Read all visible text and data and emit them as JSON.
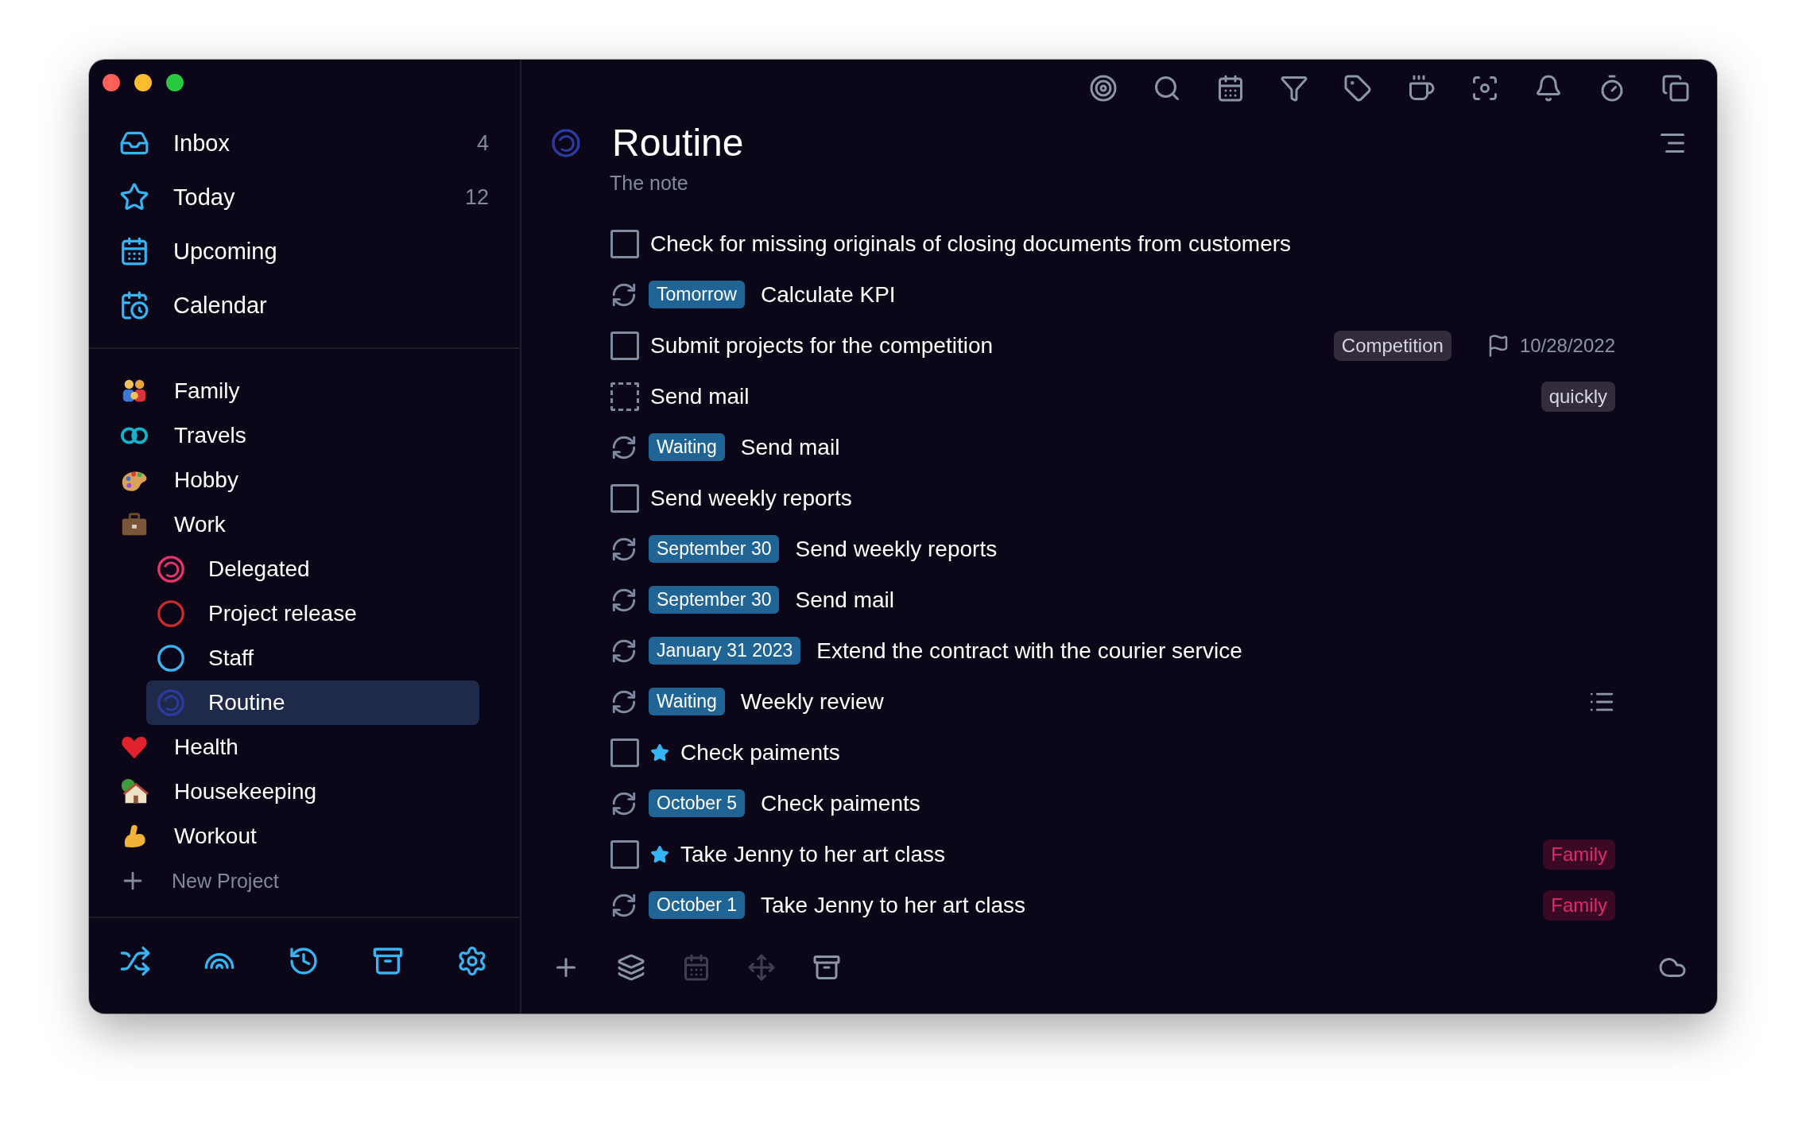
{
  "sidebar": {
    "nav": [
      {
        "label": "Inbox",
        "count": "4",
        "selected": false
      },
      {
        "label": "Today",
        "count": "12",
        "selected": false
      },
      {
        "label": "Upcoming",
        "selected": false
      },
      {
        "label": "Calendar",
        "selected": false
      }
    ],
    "projects": [
      {
        "label": "Family",
        "selected": false
      },
      {
        "label": "Travels",
        "selected": false
      },
      {
        "label": "Hobby",
        "selected": false
      },
      {
        "label": "Work",
        "selected": false,
        "children": [
          {
            "label": "Delegated",
            "kind": "partial",
            "color": "#e8336b",
            "selected": false
          },
          {
            "label": "Project release",
            "kind": "full",
            "color": "#c92a2a",
            "selected": false
          },
          {
            "label": "Staff",
            "kind": "full",
            "color": "#3db4f2",
            "selected": false
          },
          {
            "label": "Routine",
            "kind": "partial",
            "color": "#2b3a9c",
            "selected": true
          }
        ]
      },
      {
        "label": "Health",
        "selected": false
      },
      {
        "label": "Housekeeping",
        "selected": false
      },
      {
        "label": "Workout",
        "selected": false
      }
    ],
    "new_project": "New Project"
  },
  "project": {
    "title": "Routine",
    "note": "The note"
  },
  "tasks": [
    {
      "kind": "checkbox",
      "checked": false,
      "starred": false,
      "title": "Check for missing originals of closing documents from customers"
    },
    {
      "kind": "repeat",
      "badge": "Tomorrow",
      "title": "Calculate KPI"
    },
    {
      "kind": "checkbox",
      "checked": false,
      "starred": false,
      "title": "Submit projects for the competition",
      "tags": [
        {
          "label": "Competition",
          "color": "#322c3c"
        }
      ],
      "deadline": "10/28/2022"
    },
    {
      "kind": "someday",
      "checked": false,
      "starred": false,
      "title": "Send mail",
      "tags": [
        {
          "label": "quickly",
          "color": "#322c3c"
        }
      ]
    },
    {
      "kind": "repeat",
      "badge": "Waiting",
      "title": "Send mail"
    },
    {
      "kind": "checkbox",
      "checked": false,
      "starred": false,
      "title": "Send weekly reports"
    },
    {
      "kind": "repeat",
      "badge": "September 30",
      "title": "Send weekly reports"
    },
    {
      "kind": "repeat",
      "badge": "September 30",
      "title": "Send mail"
    },
    {
      "kind": "repeat",
      "badge": "January 31 2023",
      "title": "Extend the contract with the courier service"
    },
    {
      "kind": "repeat",
      "badge": "Waiting",
      "title": "Weekly review",
      "has_notes": true
    },
    {
      "kind": "checkbox",
      "checked": false,
      "starred": true,
      "title": "Check paiments"
    },
    {
      "kind": "repeat",
      "badge": "October 5",
      "title": "Check paiments"
    },
    {
      "kind": "checkbox",
      "checked": false,
      "starred": true,
      "title": "Take Jenny to her art class",
      "tags": [
        {
          "label": "Family",
          "color": "#3a0a24"
        }
      ]
    },
    {
      "kind": "repeat",
      "badge": "October 1",
      "title": "Take Jenny to her art class",
      "tags": [
        {
          "label": "Family",
          "color": "#3a0a24"
        }
      ]
    }
  ]
}
